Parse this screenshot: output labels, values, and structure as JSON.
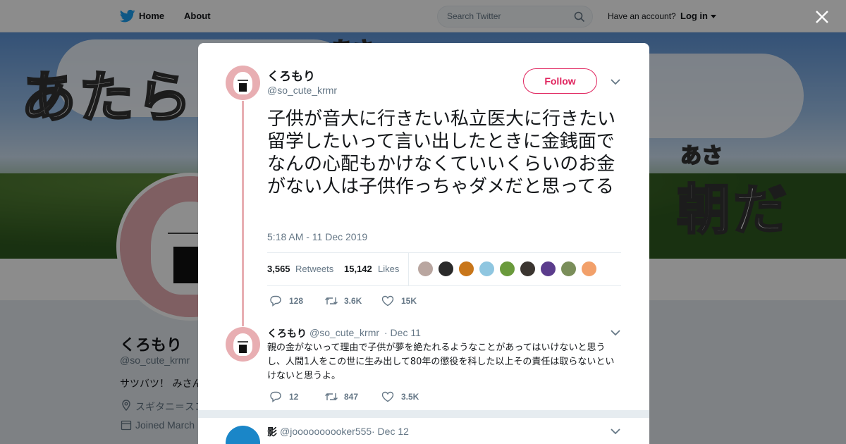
{
  "topnav": {
    "home_label": "Home",
    "about_label": "About",
    "search_placeholder": "Search Twitter",
    "have_account": "Have an account?",
    "login_label": "Log in"
  },
  "banner": {
    "text_left": "あたらし",
    "ruby_left": "あさ",
    "text_right": "朝だ",
    "ruby_right": "あさ"
  },
  "profile": {
    "name": "くろもり",
    "handle": "@so_cute_krmr",
    "bio": "サツバツ！ みさん",
    "location": "スギタニ＝スコ",
    "joined": "Joined March"
  },
  "tweet": {
    "author_name": "くろもり",
    "author_handle": "@so_cute_krmr",
    "follow_label": "Follow",
    "text": "子供が音大に行きたい私立医大に行きたい留学したいって言い出したときに金銭面でなんの心配もかけなくていいくらいのお金がない人は子供作っちゃダメだと思ってる",
    "timestamp": "5:18 AM - 11 Dec 2019",
    "retweets_count": "3,565",
    "retweets_label": "Retweets",
    "likes_count": "15,142",
    "likes_label": "Likes",
    "likers_colors": [
      "#b9a6a0",
      "#2a2a2a",
      "#c8761a",
      "#8fc6e0",
      "#6a9a3c",
      "#3b3530",
      "#5b3c8c",
      "#7a8e5a",
      "#f2a06a"
    ],
    "actions": {
      "replies": "128",
      "retweets": "3.6K",
      "likes": "15K"
    }
  },
  "reply1": {
    "author_name": "くろもり",
    "author_handle": "@so_cute_krmr",
    "date": "· Dec 11",
    "text": "親の金がないって理由で子供が夢を絶たれるようなことがあってはいけないと思うし、人間1人をこの世に生み出して80年の懲役を科した以上その責任は取らないといけないと思うよ。",
    "actions": {
      "replies": "12",
      "retweets": "847",
      "likes": "3.5K"
    }
  },
  "reply2": {
    "author_name": "影",
    "author_handle": "@joooooooooker555",
    "date": "· Dec 12"
  },
  "colors": {
    "accent_pink": "#e0245e",
    "twitter_blue": "#1da1f2",
    "avatar_pink": "#e8aeb2"
  }
}
